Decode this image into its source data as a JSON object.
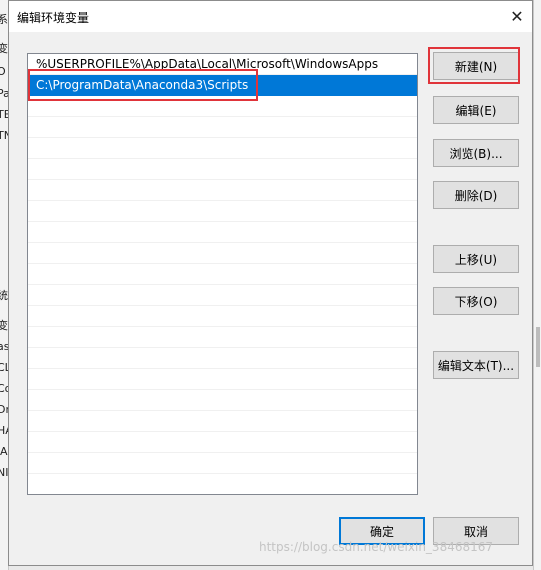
{
  "dialog": {
    "title": "编辑环境变量",
    "close_glyph": "✕"
  },
  "path_list": {
    "items": [
      "%USERPROFILE%\\AppData\\Local\\Microsoft\\WindowsApps",
      "C:\\ProgramData\\Anaconda3\\Scripts"
    ],
    "selected_index": 1
  },
  "buttons": {
    "new": "新建(N)",
    "edit": "编辑(E)",
    "browse": "浏览(B)...",
    "delete": "删除(D)",
    "move_up": "上移(U)",
    "move_down": "下移(O)",
    "edit_text": "编辑文本(T)...",
    "ok": "确定",
    "cancel": "取消"
  },
  "watermark": "https://blog.csdn.net/weixin_38468167",
  "colors": {
    "selection": "#0078d7",
    "highlight_box": "#e0343a",
    "default_button_border": "#0078d7"
  }
}
